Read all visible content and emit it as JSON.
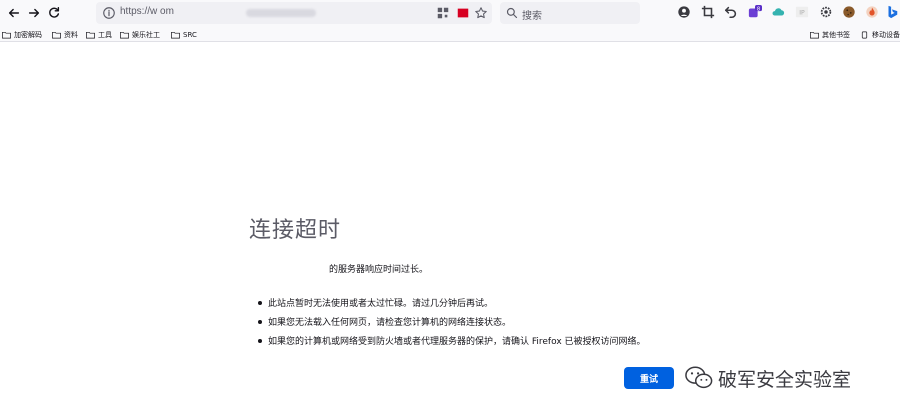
{
  "browser": {
    "url": "https://w om",
    "search_placeholder": "搜索",
    "bookmarks": [
      "加密解码",
      "资料",
      "工具",
      "娱乐社工",
      "SRC"
    ],
    "other_bookmarks": "其他书签",
    "mobile_bookmarks": "移动设备",
    "extensions": [
      "account-icon",
      "crop-icon",
      "undo-icon",
      "extension-badge-icon",
      "cloud-icon",
      "ip-icon",
      "gear-icon",
      "cookie-icon",
      "fire-icon",
      "bing-icon"
    ],
    "extension_badge": "8",
    "ip_text": "IP"
  },
  "error": {
    "title": "连接超时",
    "description": "的服务器响应时间过长。",
    "tips": [
      "此站点暂时无法使用或者太过忙碌。请过几分钟后再试。",
      "如果您无法载入任何网页，请检查您计算机的网络连接状态。",
      "如果您的计算机或网络受到防火墙或者代理服务器的保护，请确认 Firefox 已被授权访问网络。"
    ],
    "retry_label": "重试"
  },
  "watermark": {
    "text": "破军安全实验室"
  },
  "colors": {
    "accent": "#0061e0",
    "toolbar": "#f9f9fb",
    "urlbar": "#f0f0f4"
  }
}
